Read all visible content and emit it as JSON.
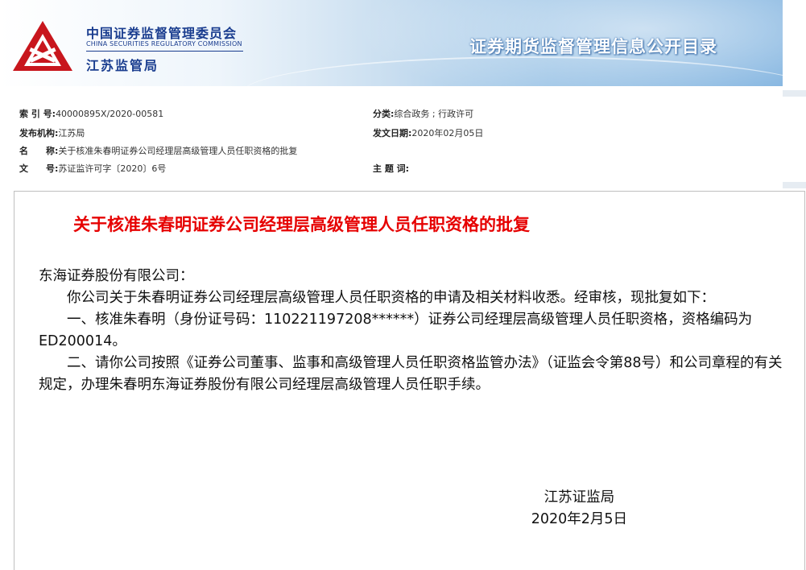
{
  "header": {
    "org_cn": "中国证券监督管理委员会",
    "org_en": "CHINA SECURITIES REGULATORY COMMISSION",
    "org_branch": "江苏监管局",
    "banner_title": "证券期货监督管理信息公开目录",
    "logo_icon": "csrc-logo-icon"
  },
  "meta": {
    "index_label": "索 引 号:",
    "index_value": "40000895X/2020-00581",
    "category_label": "分类:",
    "category_value": "综合政务 ; 行政许可",
    "issuer_label": "发布机构:",
    "issuer_value": "江苏局",
    "date_label": "发文日期:",
    "date_value": "2020年02月05日",
    "name_label": "名　　称:",
    "name_value": "关于核准朱春明证券公司经理层高级管理人员任职资格的批复",
    "docno_label": "文　　号:",
    "docno_value": "苏证监许可字〔2020〕6号",
    "keywords_label": "主 题 词:",
    "keywords_value": ""
  },
  "document": {
    "title": "关于核准朱春明证券公司经理层高级管理人员任职资格的批复",
    "salutation": "东海证券股份有限公司：",
    "para1": "你公司关于朱春明证券公司经理层高级管理人员任职资格的申请及相关材料收悉。经审核，现批复如下：",
    "para2": "一、核准朱春明（身份证号码：110221197208******）证券公司经理层高级管理人员任职资格，资格编码为ED200014。",
    "para3": "二、请你公司按照《证券公司董事、监事和高级管理人员任职资格监管办法》（证监会令第88号）和公司章程的有关规定，办理朱春明东海证券股份有限公司经理层高级管理人员任职手续。",
    "signatory": "江苏证监局",
    "sign_date": "2020年2月5日"
  },
  "colors": {
    "title_red": "#e60000",
    "brand_blue": "#1a3d8f",
    "logo_red": "#c8161d"
  }
}
